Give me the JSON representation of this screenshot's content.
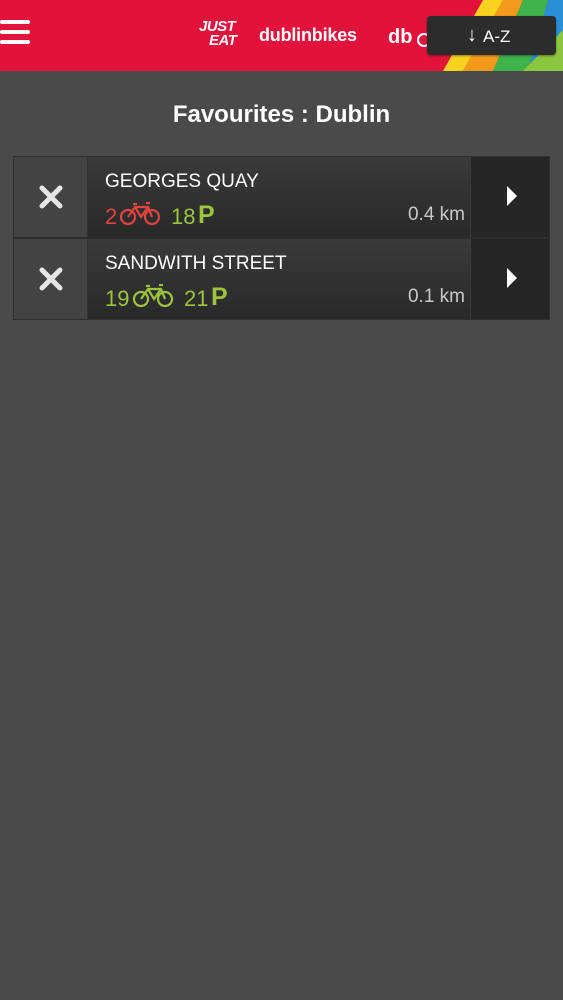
{
  "header": {
    "brand_line1": "JUST",
    "brand_line2": "EAT",
    "app_name": "dublinbikes",
    "sort_label": "A-Z",
    "sort_arrow": "↓"
  },
  "page": {
    "title": "Favourites : Dublin"
  },
  "colors": {
    "header_red": "#e3123a",
    "empty_red": "#e0443f",
    "available_green": "#9cc43c"
  },
  "favourites": [
    {
      "name": "GEORGES QUAY",
      "bikes": "2",
      "stands": "18",
      "stands_unit": "P",
      "distance": "0.4 km",
      "bikes_color": "#e0443f"
    },
    {
      "name": "SANDWITH STREET",
      "bikes": "19",
      "stands": "21",
      "stands_unit": "P",
      "distance": "0.1 km",
      "bikes_color": "#9cc43c"
    }
  ]
}
